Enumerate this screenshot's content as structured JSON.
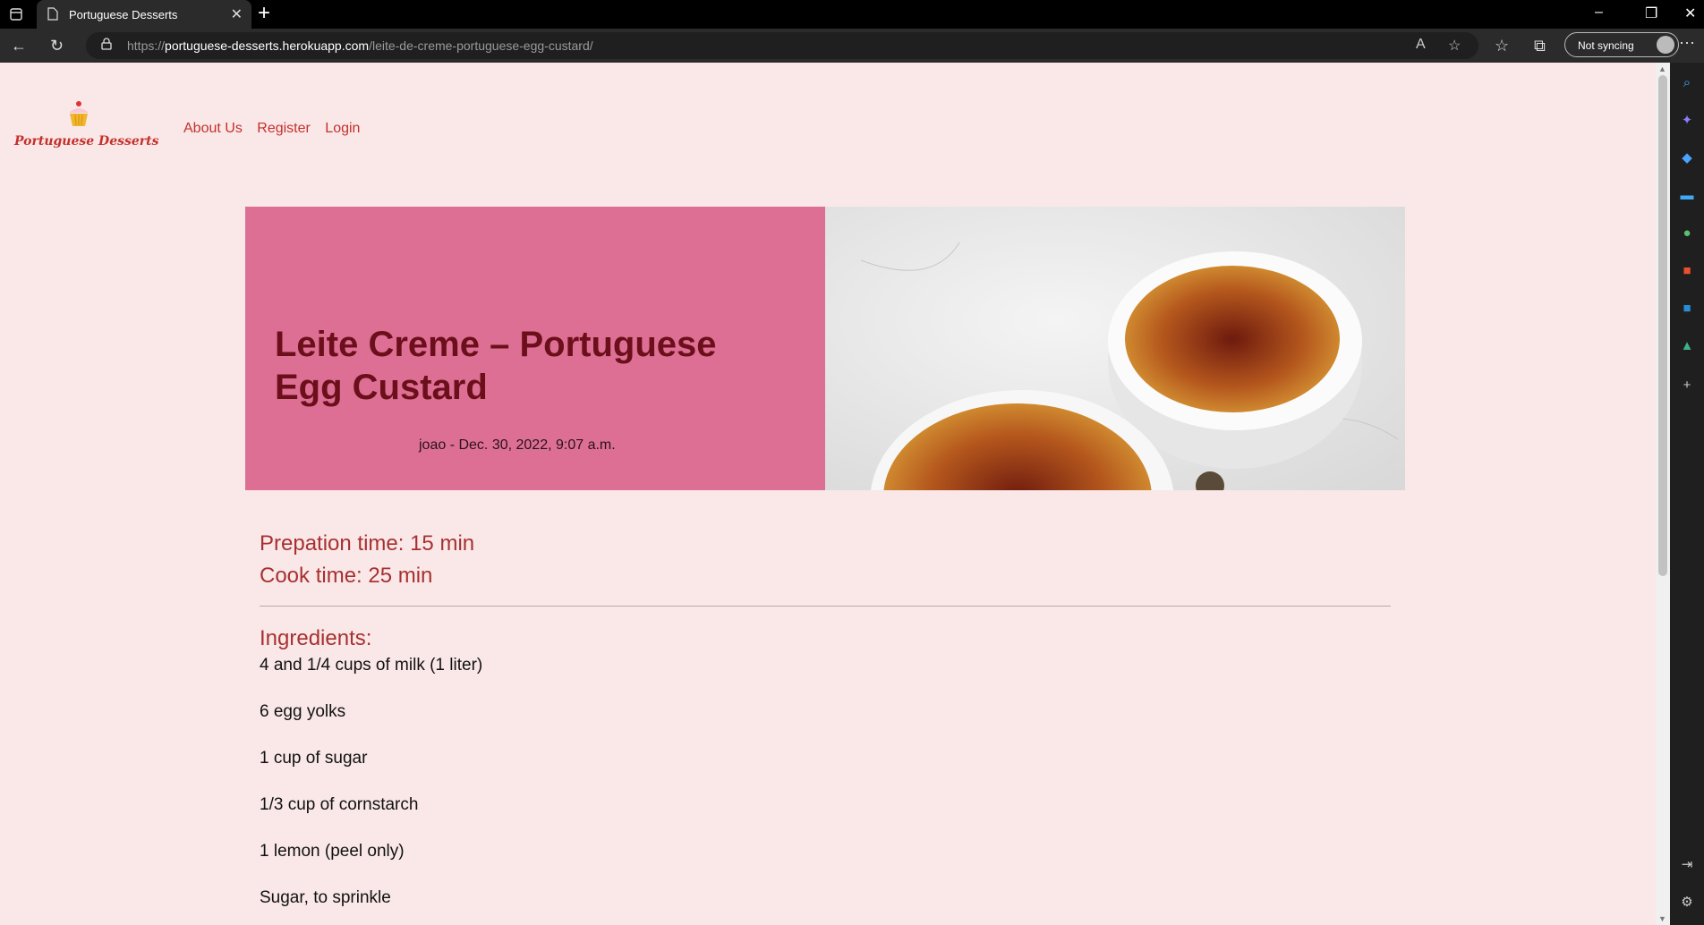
{
  "browser": {
    "tab_title": "Portuguese Desserts",
    "url_domain": "portuguese-desserts.herokuapp.com",
    "url_prefix": "https://",
    "url_path": "/leite-de-creme-portuguese-egg-custard/",
    "sync_label": "Not syncing"
  },
  "site": {
    "logo_text": "Portuguese Desserts",
    "nav": [
      "About Us",
      "Register",
      "Login"
    ]
  },
  "recipe": {
    "title": "Leite Creme – Portuguese Egg Custard",
    "meta": "joao - Dec. 30, 2022, 9:07 a.m.",
    "prep_time": "Prepation time: 15 min",
    "cook_time": "Cook time: 25 min",
    "ingredients_heading": "Ingredients:",
    "ingredients": [
      "4 and 1/4 cups of milk (1 liter)",
      "6 egg yolks",
      "1 cup of sugar",
      "1/3 cup of cornstarch",
      "1 lemon (peel only)",
      "Sugar, to sprinkle"
    ]
  },
  "colors": {
    "page_bg": "#fae8e8",
    "accent": "#c4302b",
    "hero_bg": "#dd6f95",
    "hero_title": "#6b0f1a"
  }
}
